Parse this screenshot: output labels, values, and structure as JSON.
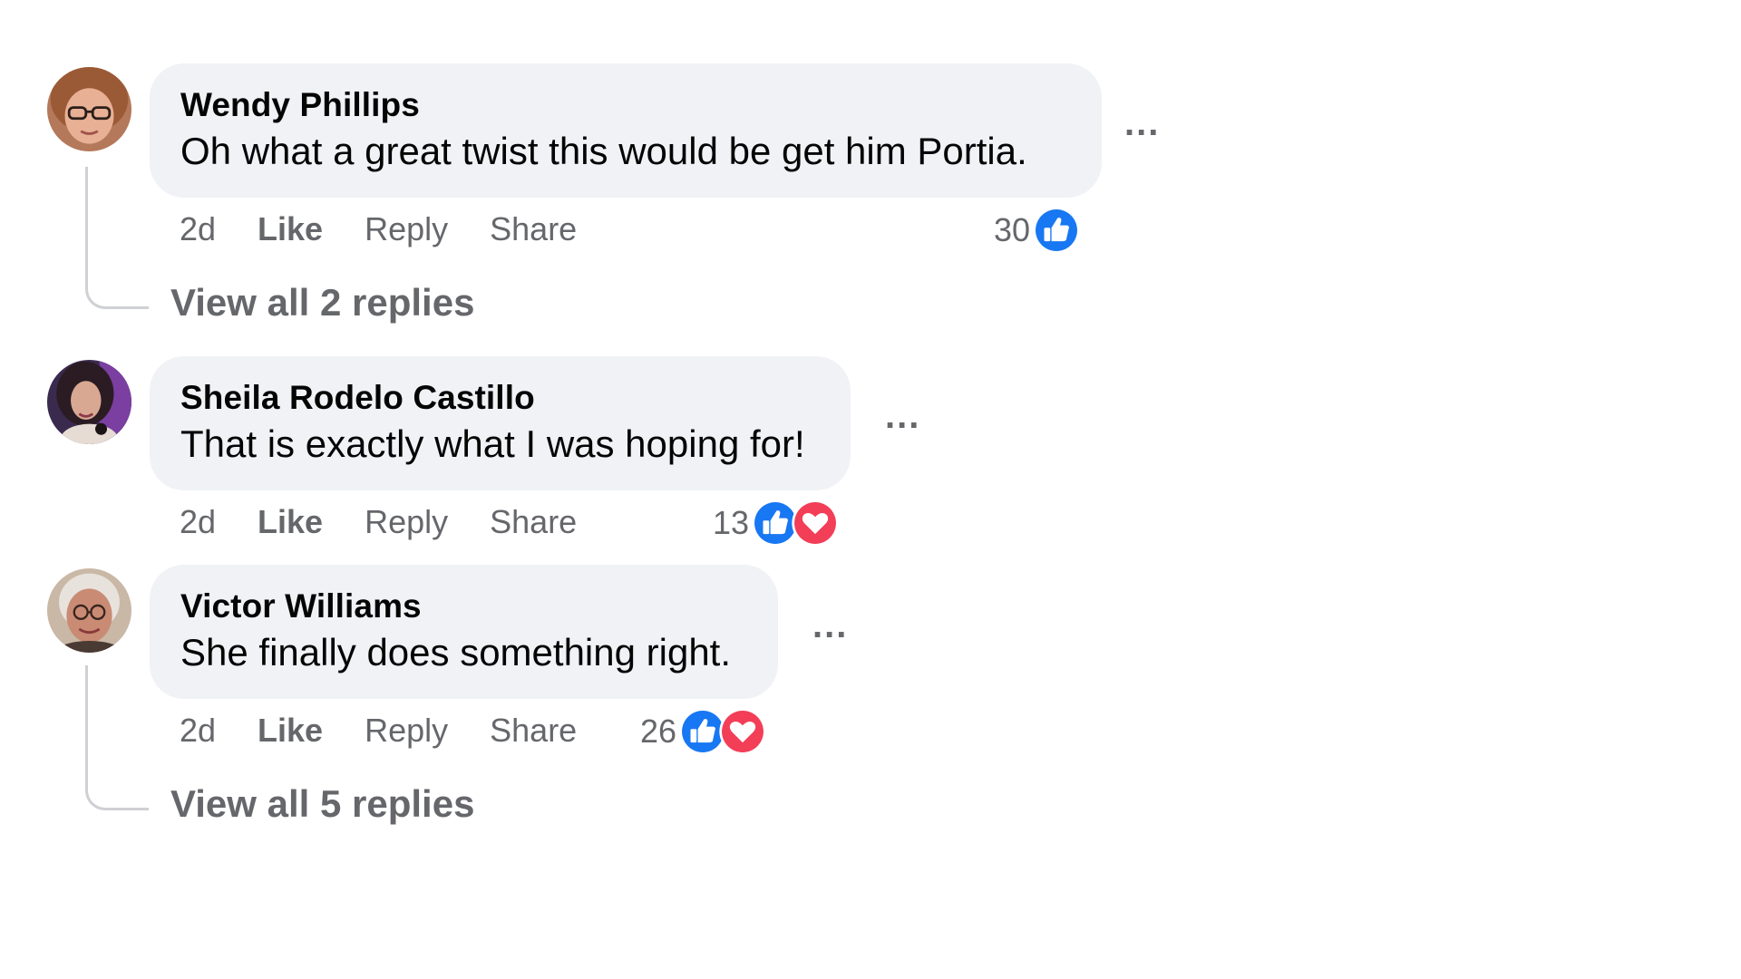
{
  "comments": [
    {
      "author": "Wendy Phillips",
      "text": "Oh what a great twist this would be get him Portia.",
      "time": "2d",
      "like_label": "Like",
      "reply_label": "Reply",
      "share_label": "Share",
      "reaction_count": "30",
      "reactions": [
        "like-icon"
      ],
      "view_replies": "View all 2 replies",
      "more_label": "..."
    },
    {
      "author": "Sheila Rodelo Castillo",
      "text": "That is exactly what I was hoping for!",
      "time": "2d",
      "like_label": "Like",
      "reply_label": "Reply",
      "share_label": "Share",
      "reaction_count": "13",
      "reactions": [
        "like-icon",
        "love-icon"
      ],
      "more_label": "..."
    },
    {
      "author": "Victor Williams",
      "text": "She finally does something right.",
      "time": "2d",
      "like_label": "Like",
      "reply_label": "Reply",
      "share_label": "Share",
      "reaction_count": "26",
      "reactions": [
        "like-icon",
        "love-icon"
      ],
      "view_replies": "View all 5 replies",
      "more_label": "..."
    }
  ],
  "colors": {
    "bubble": "#f0f2f5",
    "secondary_text": "#65676b",
    "like_blue": "#1877f2",
    "love_red": "#f33e58"
  }
}
